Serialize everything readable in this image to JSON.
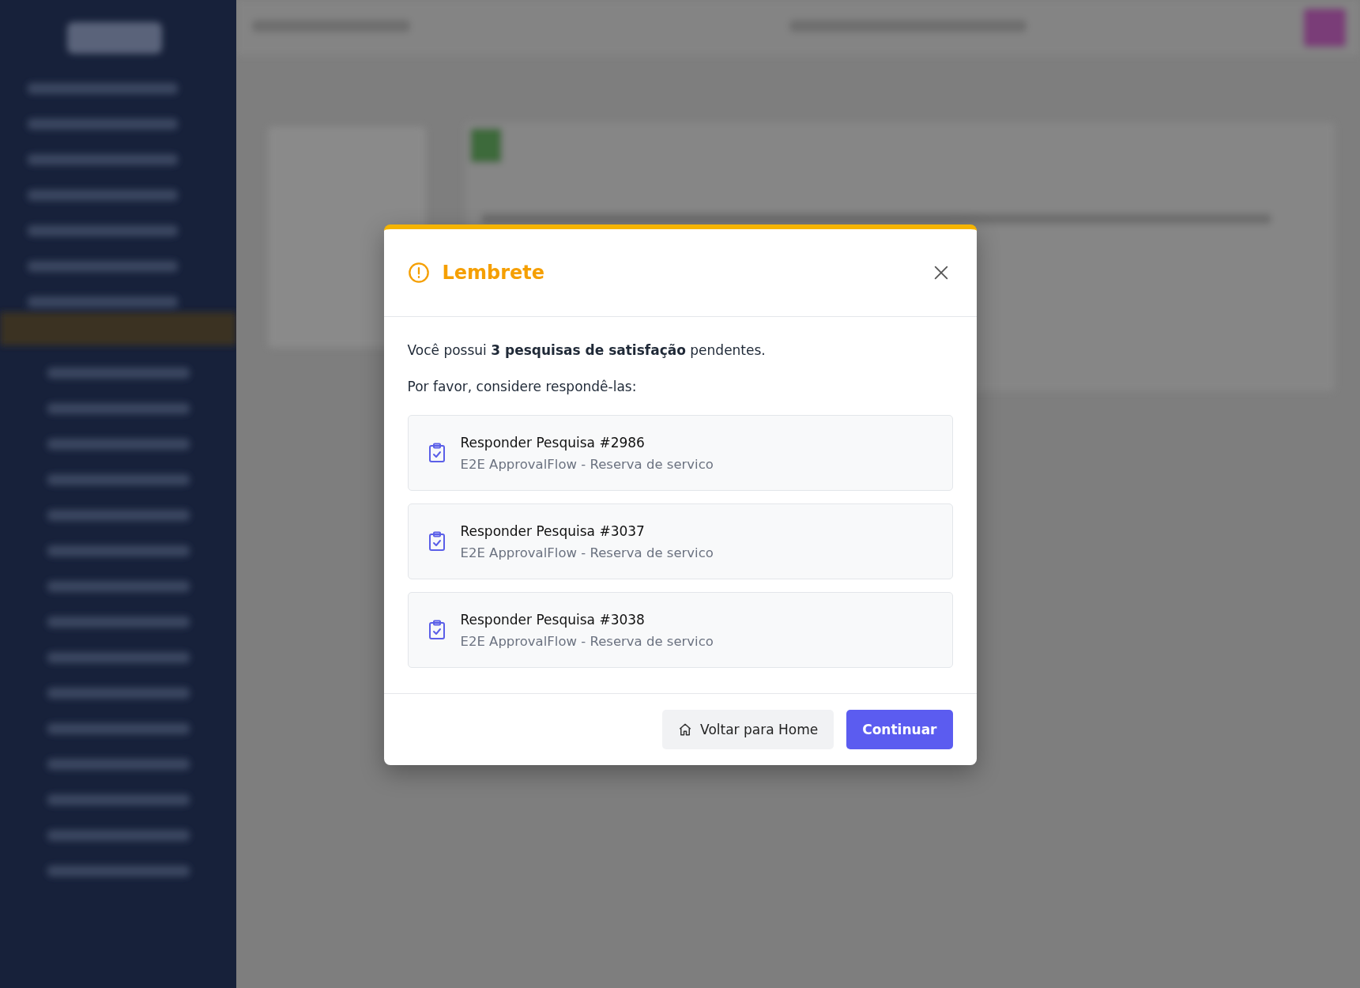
{
  "modal": {
    "title": "Lembrete",
    "intro": "Você possui **3 pesquisas de satisfação** pendentes.",
    "prompt": "Por favor, considere respondê-las:",
    "surveys": [
      {
        "title": "Responder Pesquisa #2986",
        "subtitle": "E2E ApprovalFlow - Reserva de servico"
      },
      {
        "title": "Responder Pesquisa #3037",
        "subtitle": "E2E ApprovalFlow - Reserva de servico"
      },
      {
        "title": "Responder Pesquisa #3038",
        "subtitle": "E2E ApprovalFlow - Reserva de servico"
      }
    ],
    "buttons": [
      {
        "label": "Voltar para Home",
        "kind": "secondary"
      },
      {
        "label": "Continuar",
        "kind": "primary"
      }
    ]
  }
}
